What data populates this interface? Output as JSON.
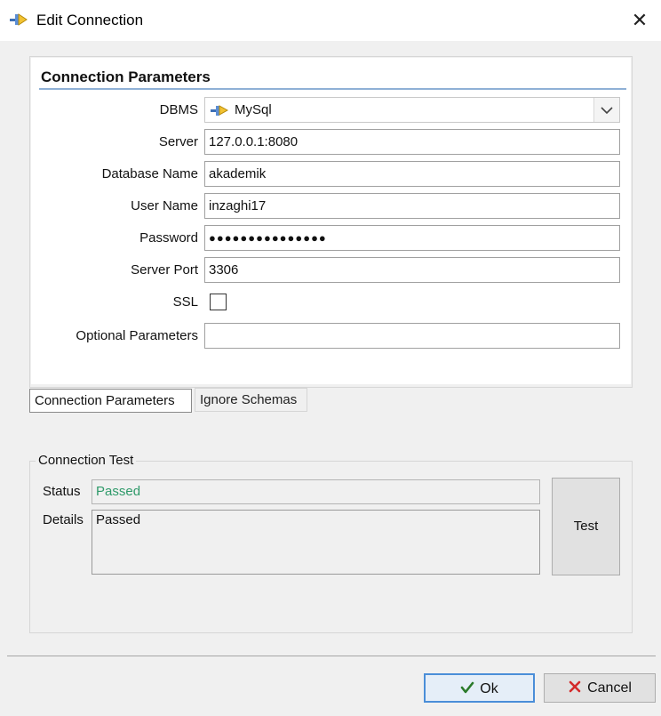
{
  "window": {
    "title": "Edit Connection",
    "close_glyph": "✕"
  },
  "connection_parameters": {
    "section_title": "Connection Parameters",
    "dbms_label": "DBMS",
    "dbms_value": "MySql",
    "server_label": "Server",
    "server_value": "127.0.0.1:8080",
    "database_label": "Database Name",
    "database_value": "akademik",
    "user_label": "User Name",
    "user_value": "inzaghi17",
    "password_label": "Password",
    "password_mask": "●●●●●●●●●●●●●●●",
    "port_label": "Server Port",
    "port_value": "3306",
    "ssl_label": "SSL",
    "ssl_checked": false,
    "optional_label": "Optional Parameters",
    "optional_value": ""
  },
  "tabs": [
    {
      "label": "Connection Parameters",
      "active": true
    },
    {
      "label": "Ignore Schemas",
      "active": false
    }
  ],
  "connection_test": {
    "group_title": "Connection Test",
    "status_label": "Status",
    "status_value": "Passed",
    "status_color": "#2f9a6a",
    "details_label": "Details",
    "details_value": "Passed",
    "test_button": "Test"
  },
  "footer": {
    "ok_label": "Ok",
    "ok_icon": "checkmark-icon",
    "cancel_label": "Cancel",
    "cancel_icon": "x-cross-icon"
  }
}
